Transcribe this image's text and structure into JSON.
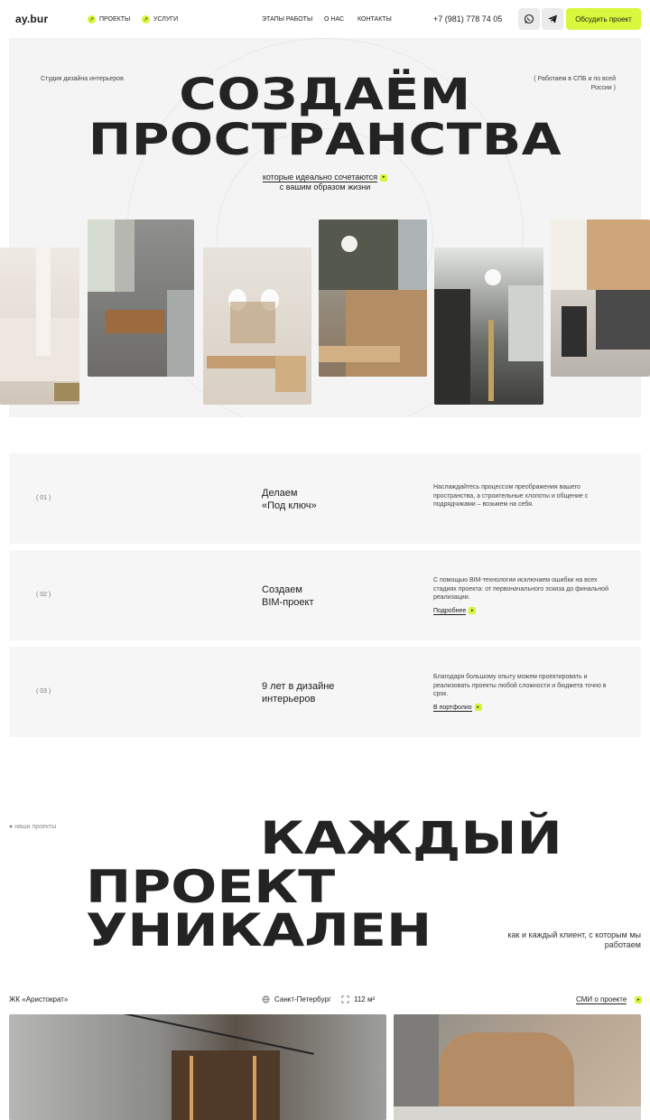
{
  "header": {
    "logo": "ay.bur",
    "nav_pills": [
      "ПРОЕКТЫ",
      "УСЛУГИ"
    ],
    "nav_links": [
      "ЭТАПЫ РАБОТЫ",
      "О НАС",
      "КОНТАКТЫ"
    ],
    "phone": "+7 (981) 778 74 05",
    "social_icons": [
      "whatsapp-icon",
      "telegram-icon"
    ],
    "cta": "Обсудить проект",
    "accent": "#d9f73d"
  },
  "hero": {
    "studio": "Студия дизайна интерьеров",
    "work_area": "( Работаем в СПБ и по всей России )",
    "title_line1": "СОЗДАЁМ",
    "title_line2": "ПРОСТРАНСТВА",
    "sub_line1": "которые идеально сочетаются",
    "sub_line2": "с вашим образом жизни"
  },
  "features": [
    {
      "num": "( 01 )",
      "title_l1": "Делаем",
      "title_l2": "«Под ключ»",
      "desc": "Наслаждайтесь процессом преображения вашего пространства, а строительные хлопоты и общение с подрядчиками – возьмем на себя.",
      "link": ""
    },
    {
      "num": "( 02 )",
      "title_l1": "Создаем",
      "title_l2": "BIM-проект",
      "desc": "С помощью BIM-технологии исключаем ошибки на всех стадиях проекта: от первоначального эскиза до финальной реализации.",
      "link": "Подробнее"
    },
    {
      "num": "( 03 )",
      "title_l1": "9 лет в дизайне",
      "title_l2": "интерьеров",
      "desc": "Благодаря большому опыту можем проектировать и реализовать проекты любой сложности и бюджета точно в срок.",
      "link": "В портфолио"
    }
  ],
  "projects": {
    "label": "наши проекты",
    "title_l1": "КАЖДЫЙ",
    "title_l2": "ПРОЕКТ",
    "title_l3": "УНИКАЛЕН",
    "note": "как и каждый клиент, с которым мы работаем",
    "card": {
      "name": "ЖК «Аристократ»",
      "city": "Санкт-Петербург",
      "area": "112 м²",
      "media_link": "СМИ о проекте"
    }
  }
}
